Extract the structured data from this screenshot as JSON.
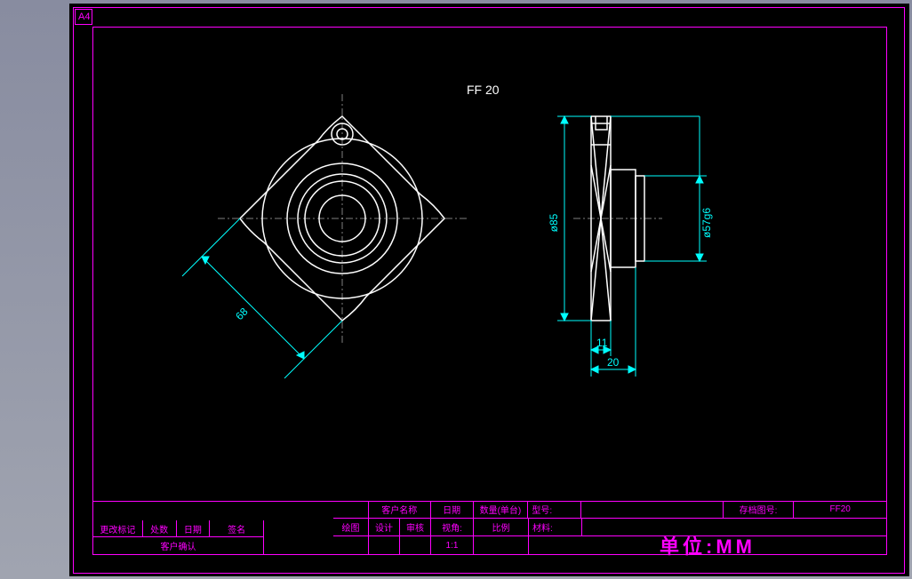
{
  "sheet": {
    "format": "A4"
  },
  "part": {
    "title": "FF 20"
  },
  "dimensions": {
    "diag": "68",
    "dia85": "ø85",
    "dia57": "ø57g6",
    "depth11": "11",
    "depth20": "20"
  },
  "title_block": {
    "left": {
      "change_mark": "更改标记",
      "qty": "处数",
      "date": "日期",
      "sign": "签名",
      "customer_confirm": "客户确认"
    },
    "main": {
      "customer_name": "客户名称",
      "date_h": "日期",
      "qty_unit": "数量(单台)",
      "model": "型号:",
      "archive": "存档图号:",
      "archive_val": "FF20",
      "draw": "绘图",
      "design": "设计",
      "review": "审核",
      "viewangle": "视角:",
      "scale": "比例",
      "scale_val": "1:1",
      "material": "材料:",
      "unit": "单位:MM"
    }
  },
  "chart_data": {
    "type": "engineering-drawing",
    "part_id": "FF 20",
    "views": [
      "front",
      "side"
    ],
    "dimensions_mm": {
      "bolt_circle_diag": 68,
      "outer_diameter": 85,
      "pilot_diameter": "57g6",
      "flange_thickness": 11,
      "total_depth": 20
    },
    "scale": "1:1",
    "units": "MM",
    "sheet_format": "A4"
  }
}
